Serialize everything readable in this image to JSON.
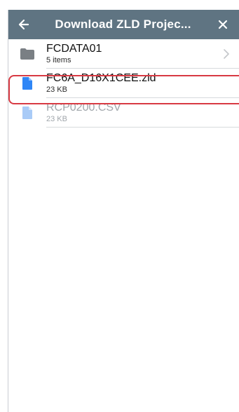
{
  "header": {
    "title": "Download ZLD Projec...",
    "back_icon": "arrow-left-icon",
    "close_icon": "close-icon"
  },
  "files": [
    {
      "name": "FCDATA01",
      "meta": "5 items",
      "type": "folder",
      "icon": "folder-icon",
      "enabled": true,
      "selected": false
    },
    {
      "name": "FC6A_D16X1CEE.zld",
      "meta": "23 KB",
      "type": "file",
      "icon": "file-icon",
      "enabled": true,
      "selected": true
    },
    {
      "name": "RCP0200.CSV",
      "meta": "23 KB",
      "type": "file",
      "icon": "file-icon",
      "enabled": false,
      "selected": false
    }
  ],
  "colors": {
    "header_bg": "#5f7482",
    "file_icon_active": "#2f86f6",
    "file_icon_disabled": "#a9cbf7",
    "folder_icon": "#7a7f84",
    "selection_border": "#d83a43"
  }
}
